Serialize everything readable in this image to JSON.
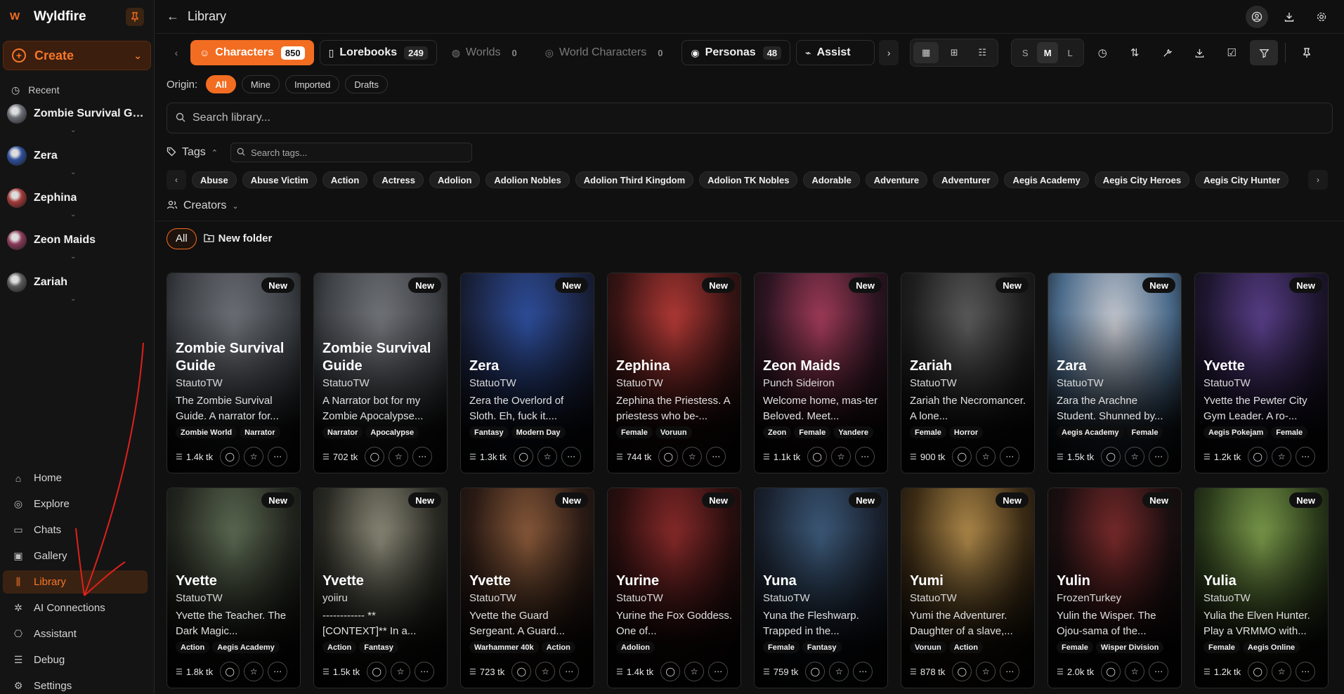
{
  "app": {
    "name": "Wyldfire"
  },
  "sidebar": {
    "create_label": "Create",
    "recent_label": "Recent",
    "recent": [
      {
        "name": "Zombie Survival Gui...",
        "color": "#6b6f76"
      },
      {
        "name": "Zera",
        "color": "#2f4f9a"
      },
      {
        "name": "Zephina",
        "color": "#a33a3a"
      },
      {
        "name": "Zeon Maids",
        "color": "#8a3a58"
      },
      {
        "name": "Zariah",
        "color": "#5a5a5a"
      }
    ],
    "nav": [
      {
        "label": "Home",
        "icon": "home-icon"
      },
      {
        "label": "Explore",
        "icon": "compass-icon"
      },
      {
        "label": "Chats",
        "icon": "chat-icon"
      },
      {
        "label": "Gallery",
        "icon": "image-icon"
      },
      {
        "label": "Library",
        "icon": "library-icon",
        "active": true
      },
      {
        "label": "AI Connections",
        "icon": "ai-icon"
      },
      {
        "label": "Assistant",
        "icon": "bot-icon"
      },
      {
        "label": "Debug",
        "icon": "database-icon"
      },
      {
        "label": "Settings",
        "icon": "gear-icon"
      }
    ]
  },
  "header": {
    "title": "Library"
  },
  "type_tabs": [
    {
      "label": "Characters",
      "count": "850",
      "state": "active"
    },
    {
      "label": "Lorebooks",
      "count": "249",
      "state": "normal"
    },
    {
      "label": "Worlds",
      "count": "0",
      "state": "disabled"
    },
    {
      "label": "World Characters",
      "count": "0",
      "state": "disabled"
    },
    {
      "label": "Personas",
      "count": "48",
      "state": "normal"
    },
    {
      "label": "Assist",
      "count": "",
      "state": "clip"
    }
  ],
  "size_options": [
    "S",
    "M",
    "L"
  ],
  "origin": {
    "label": "Origin:",
    "options": [
      "All",
      "Mine",
      "Imported",
      "Drafts"
    ]
  },
  "search": {
    "placeholder": "Search library..."
  },
  "tags": {
    "label": "Tags",
    "search_placeholder": "Search tags...",
    "chips": [
      "Abuse",
      "Abuse Victim",
      "Action",
      "Actress",
      "Adolion",
      "Adolion Nobles",
      "Adolion Third Kingdom",
      "Adolion TK Nobles",
      "Adorable",
      "Adventure",
      "Adventurer",
      "Aegis Academy",
      "Aegis City Heroes",
      "Aegis City Hunter"
    ]
  },
  "creators": {
    "label": "Creators"
  },
  "folders": {
    "all_label": "All",
    "new_folder_label": "New folder"
  },
  "badge_new": "New",
  "cards": [
    {
      "title": "Zombie Survival Guide",
      "author": "StautoTW",
      "desc": "The Zombie Survival Guide. A narrator for...",
      "tags": [
        "Zombie World",
        "Narrator"
      ],
      "tokens": "1.4k tk",
      "c1": "#6d7177",
      "c2": "#3b3f44"
    },
    {
      "title": "Zombie Survival Guide",
      "author": "StatuoTW",
      "desc": "A Narrator bot for my Zombie Apocalypse...",
      "tags": [
        "Narrator",
        "Apocalypse"
      ],
      "tokens": "702 tk",
      "c1": "#72757a",
      "c2": "#3d4045"
    },
    {
      "title": "Zera",
      "author": "StatuoTW",
      "desc": "Zera the Overlord of Sloth. Eh, fuck it....",
      "tags": [
        "Fantasy",
        "Modern Day"
      ],
      "tokens": "1.3k tk",
      "c1": "#2e4f9e",
      "c2": "#1a2340"
    },
    {
      "title": "Zephina",
      "author": "StatuoTW",
      "desc": "Zephina the Priestess. A priestess who be-...",
      "tags": [
        "Female",
        "Voruun"
      ],
      "tokens": "744 tk",
      "c1": "#b43a36",
      "c2": "#3a1414"
    },
    {
      "title": "Zeon Maids",
      "author": "Punch Sideiron",
      "desc": "Welcome home, mas-ter Beloved. Meet...",
      "tags": [
        "Zeon",
        "Female",
        "Yandere"
      ],
      "tokens": "1.1k tk",
      "c1": "#a33c5a",
      "c2": "#2c1420"
    },
    {
      "title": "Zariah",
      "author": "StatuoTW",
      "desc": "Zariah the Necromancer. A lone...",
      "tags": [
        "Female",
        "Horror"
      ],
      "tokens": "900 tk",
      "c1": "#5c5c5c",
      "c2": "#1e1e1e"
    },
    {
      "title": "Zara",
      "author": "StatuoTW",
      "desc": "Zara the Arachne Student. Shunned by...",
      "tags": [
        "Aegis Academy",
        "Female"
      ],
      "tokens": "1.5k tk",
      "c1": "#c7c9cf",
      "c2": "#4a6a8a"
    },
    {
      "title": "Yvette",
      "author": "StatuoTW",
      "desc": "Yvette the Pewter City Gym Leader. A ro-...",
      "tags": [
        "Aegis Pokejam",
        "Female"
      ],
      "tokens": "1.2k tk",
      "c1": "#5a3f8a",
      "c2": "#1e1630"
    },
    {
      "title": "Yvette",
      "author": "StatuoTW",
      "desc": "Yvette the Teacher. The Dark Magic...",
      "tags": [
        "Action",
        "Aegis Academy"
      ],
      "tokens": "1.8k tk",
      "c1": "#5c6a52",
      "c2": "#23261f"
    },
    {
      "title": "Yvette",
      "author": "yoiiru",
      "desc": "------------ ** [CONTEXT]** In a...",
      "tags": [
        "Action",
        "Fantasy"
      ],
      "tokens": "1.5k tk",
      "c1": "#8b8a78",
      "c2": "#2a2a24"
    },
    {
      "title": "Yvette",
      "author": "StatuoTW",
      "desc": "Yvette the Guard Sergeant. A Guard...",
      "tags": [
        "Warhammer 40k",
        "Action"
      ],
      "tokens": "723 tk",
      "c1": "#8a5a3a",
      "c2": "#2a1a14"
    },
    {
      "title": "Yurine",
      "author": "StatuoTW",
      "desc": "Yurine the Fox Goddess. One of...",
      "tags": [
        "Adolion"
      ],
      "tokens": "1.4k tk",
      "c1": "#8a2a2a",
      "c2": "#2a0e0e"
    },
    {
      "title": "Yuna",
      "author": "StatuoTW",
      "desc": "Yuna the Fleshwarp. Trapped in the...",
      "tags": [
        "Female",
        "Fantasy"
      ],
      "tokens": "759 tk",
      "c1": "#3c5a7a",
      "c2": "#1a2230"
    },
    {
      "title": "Yumi",
      "author": "StatuoTW",
      "desc": "Yumi the Adventurer. Daughter of a slave,...",
      "tags": [
        "Voruun",
        "Action"
      ],
      "tokens": "878 tk",
      "c1": "#b08a4a",
      "c2": "#3a2a14"
    },
    {
      "title": "Yulin",
      "author": "FrozenTurkey",
      "desc": "Yulin the Wisper. The Ojou-sama of the...",
      "tags": [
        "Female",
        "Wisper Division"
      ],
      "tokens": "2.0k tk",
      "c1": "#7a2a2a",
      "c2": "#1a0e10"
    },
    {
      "title": "Yulia",
      "author": "StatuoTW",
      "desc": "Yulia the Elven Hunter. Play a VRMMO with...",
      "tags": [
        "Female",
        "Aegis Online"
      ],
      "tokens": "1.2k tk",
      "c1": "#7a9a4a",
      "c2": "#2a3a1a"
    }
  ]
}
